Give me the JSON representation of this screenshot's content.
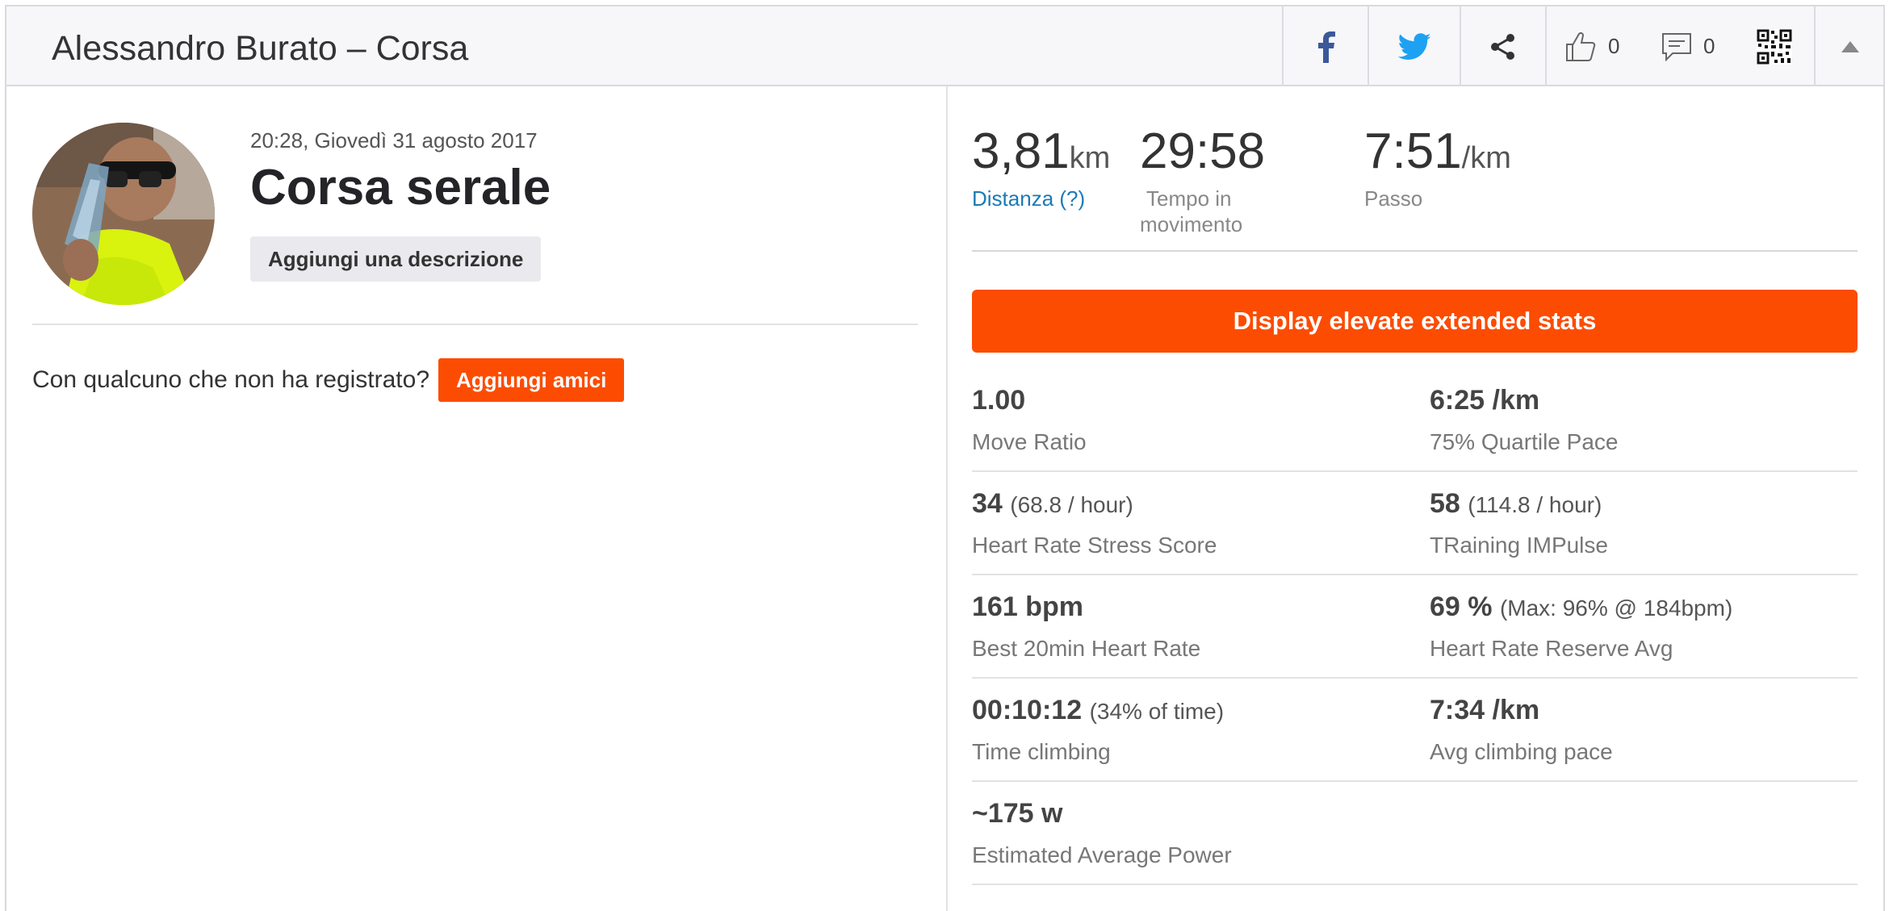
{
  "header": {
    "title": "Alessandro Burato – Corsa",
    "kudos_count": "0",
    "comments_count": "0"
  },
  "activity": {
    "datetime": "20:28, Giovedì 31 agosto 2017",
    "name": "Corsa serale",
    "add_description": "Aggiungi una descrizione",
    "friends_question": "Con qualcuno che non ha registrato?",
    "add_friends": "Aggiungi amici"
  },
  "summary": {
    "distance": {
      "value": "3,81",
      "unit": "km",
      "label": "Distanza (?)"
    },
    "moving_time": {
      "value": "29:58",
      "label_line1": "Tempo in",
      "label_line2": "movimento"
    },
    "pace": {
      "value": "7:51",
      "unit": "/km",
      "label": "Passo"
    }
  },
  "extended_button": "Display elevate extended stats",
  "stats": [
    [
      {
        "value": "1.00",
        "extra": "",
        "label": "Move Ratio"
      },
      {
        "value": "6:25 /km",
        "extra": "",
        "label": "75% Quartile Pace"
      }
    ],
    [
      {
        "value": "34",
        "extra": "(68.8 / hour)",
        "label": "Heart Rate Stress Score"
      },
      {
        "value": "58",
        "extra": "(114.8 / hour)",
        "label": "TRaining IMPulse"
      }
    ],
    [
      {
        "value": "161 bpm",
        "extra": "",
        "label": "Best 20min Heart Rate"
      },
      {
        "value": "69 %",
        "extra": "(Max: 96% @ 184bpm)",
        "label": "Heart Rate Reserve Avg"
      }
    ],
    [
      {
        "value": "00:10:12",
        "extra": "(34% of time)",
        "label": "Time climbing"
      },
      {
        "value": "7:34 /km",
        "extra": "",
        "label": "Avg climbing pace"
      }
    ],
    [
      {
        "value": "~175 w",
        "extra": "",
        "label": "Estimated Average Power"
      }
    ]
  ],
  "colors": {
    "accent": "#fc4c02",
    "facebook": "#3b5998",
    "twitter": "#1da1f2",
    "link": "#1a7ab8"
  }
}
